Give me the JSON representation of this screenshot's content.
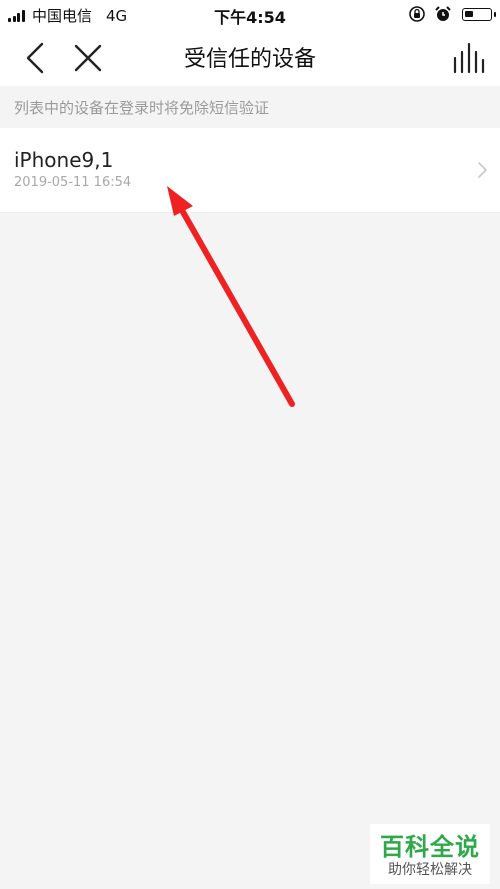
{
  "status_bar": {
    "carrier": "中国电信",
    "network": "4G",
    "time": "下午4:54"
  },
  "nav": {
    "title": "受信任的设备",
    "back_icon": "chevron-left-icon",
    "close_icon": "close-icon",
    "menu_icon": "bars-chart-icon"
  },
  "hint": "列表中的设备在登录时将免除短信验证",
  "devices": [
    {
      "name": "iPhone9,1",
      "time": "2019-05-11 16:54"
    }
  ],
  "annotation": {
    "color": "#ee2222"
  },
  "watermark": {
    "title": "百科全说",
    "subtitle": "助你轻松解决"
  },
  "colors": {
    "background": "#f4f4f4",
    "watermark_green": "#2fa84a"
  }
}
